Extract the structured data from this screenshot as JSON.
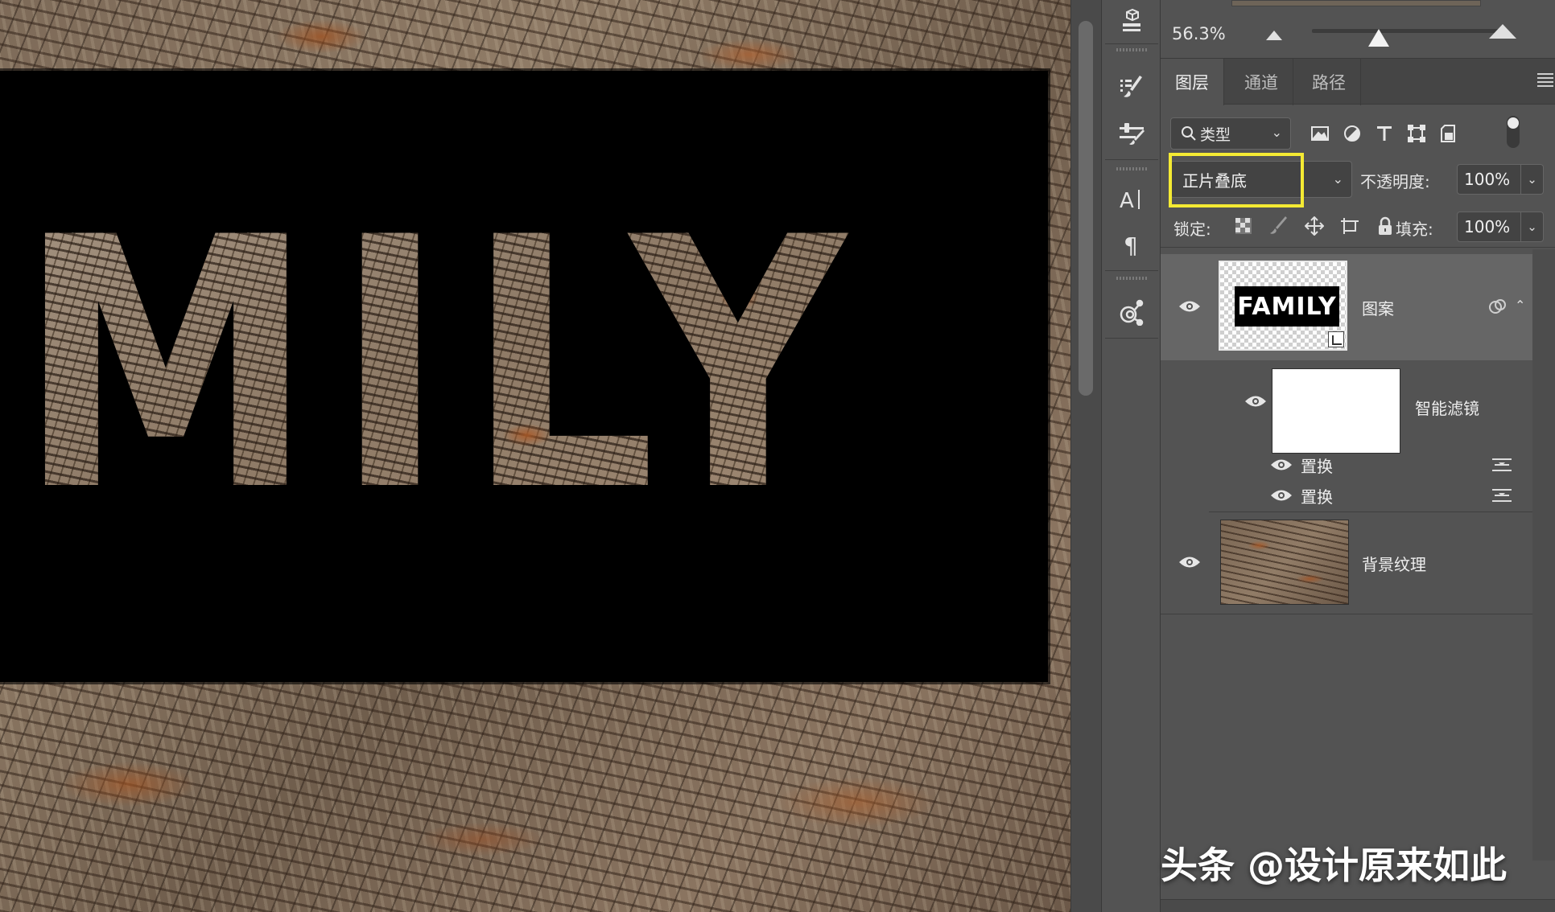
{
  "canvas": {
    "word": "MILY"
  },
  "zoom": {
    "value": "56.3%"
  },
  "tabs": [
    {
      "label": "图层"
    },
    {
      "label": "通道"
    },
    {
      "label": "路径"
    }
  ],
  "filter": {
    "kind_label": "类型"
  },
  "blend": {
    "mode": "正片叠底",
    "opacity_label": "不透明度:",
    "opacity_value": "100%"
  },
  "lock": {
    "label": "锁定:",
    "fill_label": "填充:",
    "fill_value": "100%"
  },
  "layers": {
    "pattern": {
      "name": "图案",
      "thumb_text": "FAMILY"
    },
    "smart_filter": {
      "name": "智能滤镜"
    },
    "filters": [
      {
        "name": "置换"
      },
      {
        "name": "置换"
      }
    ],
    "background": {
      "name": "背景纹理"
    }
  },
  "watermark": "头条 @设计原来如此",
  "colors": {
    "highlight": "#f4ea33",
    "panel": "#535353",
    "selected": "#666666"
  }
}
